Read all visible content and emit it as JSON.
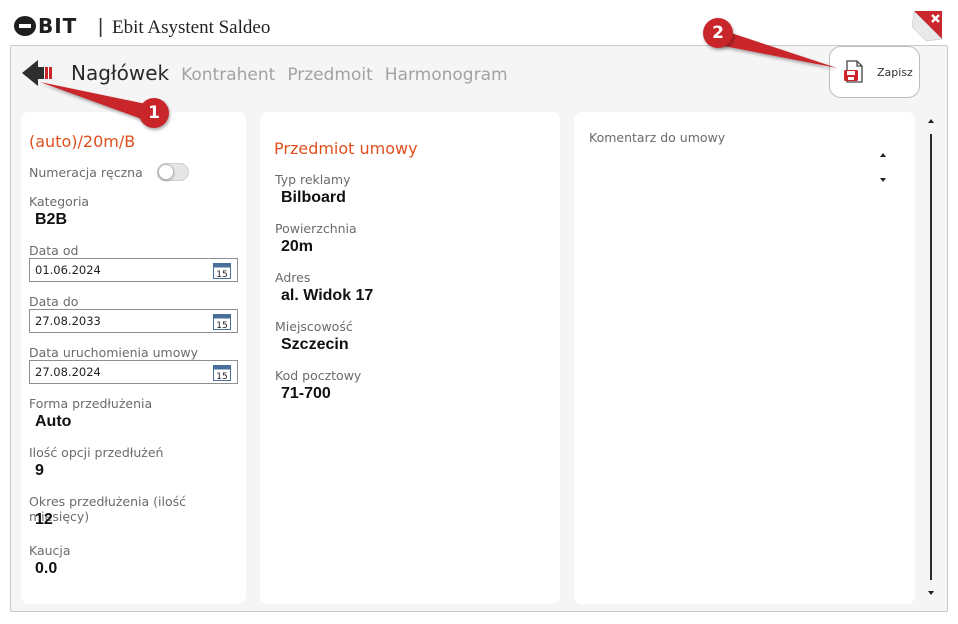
{
  "window": {
    "logo_text": "BIT",
    "title_separator": "|",
    "title": "Ebit Asystent Saldeo"
  },
  "nav": {
    "tabs": [
      {
        "label": "Nagłówek",
        "active": true
      },
      {
        "label": "Kontrahent",
        "active": false
      },
      {
        "label": "Przedmoit",
        "active": false
      },
      {
        "label": "Harmonogram",
        "active": false
      }
    ]
  },
  "toolbar": {
    "save_label": "Zapisz"
  },
  "callouts": [
    "1",
    "2"
  ],
  "colors": {
    "accent": "#e0501f",
    "callout": "#c8262a",
    "save_icon": "#d0222a"
  },
  "header_card": {
    "title": "(auto)/20m/B",
    "manual_numbering_label": "Numeracja ręczna",
    "manual_numbering_on": false,
    "category_label": "Kategoria",
    "category_value": "B2B",
    "date_from_label": "Data od",
    "date_from_value": "01.06.2024",
    "date_to_label": "Data do",
    "date_to_value": "27.08.2033",
    "start_date_label": "Data uruchomienia umowy",
    "start_date_value": "27.08.2024",
    "calendar_day": "15",
    "extension_form_label": "Forma przedłużenia",
    "extension_form_value": "Auto",
    "extension_count_label": "Ilość opcji przedłużeń",
    "extension_count_value": "9",
    "extension_period_label": "Okres przedłużenia (ilość miesięcy)",
    "extension_period_value": "12",
    "deposit_label": "Kaucja",
    "deposit_value": "0.0"
  },
  "subject_card": {
    "title": "Przedmiot umowy",
    "ad_type_label": "Typ reklamy",
    "ad_type_value": "Bilboard",
    "area_label": "Powierzchnia",
    "area_value": "20m",
    "address_label": "Adres",
    "address_value": "al. Widok 17",
    "city_label": "Miejscowość",
    "city_value": "Szczecin",
    "postal_label": "Kod pocztowy",
    "postal_value": "71-700"
  },
  "comment_card": {
    "label": "Komentarz do umowy",
    "value": ""
  }
}
